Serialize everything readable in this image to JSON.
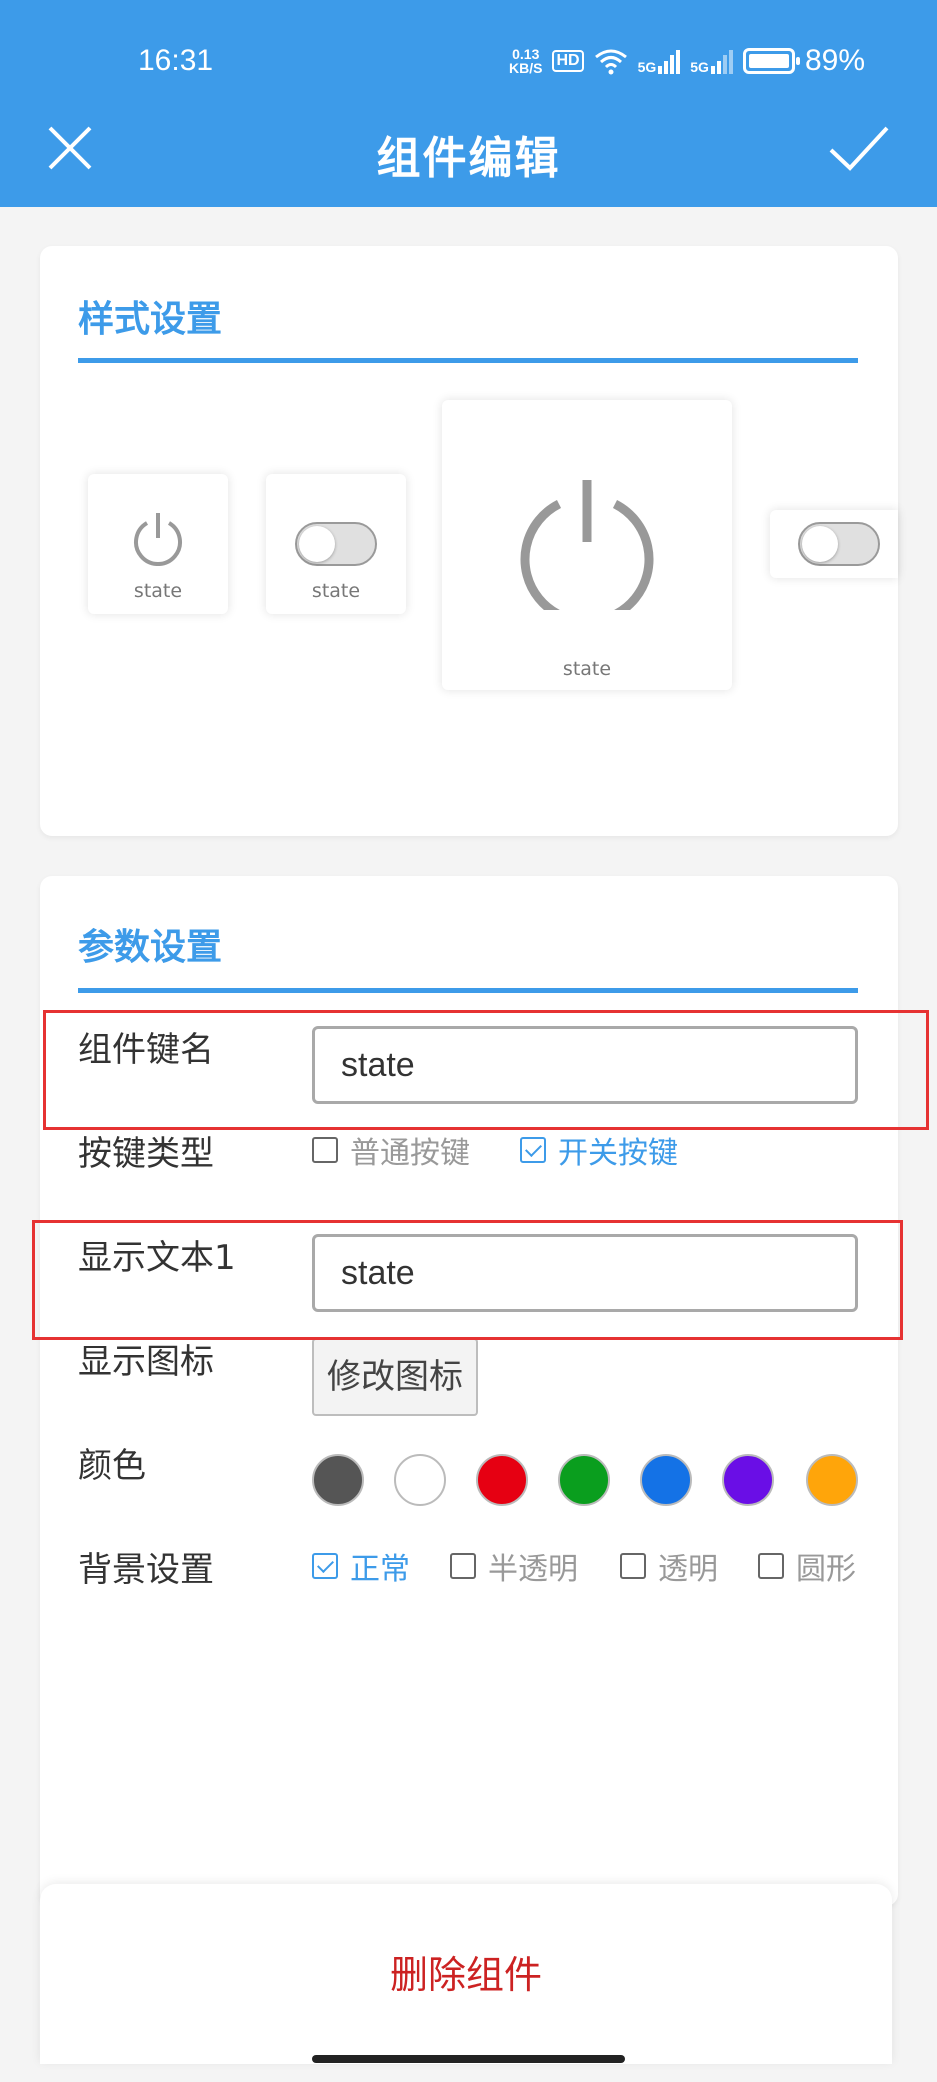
{
  "status_bar": {
    "time": "16:31",
    "net_speed_value": "0.13",
    "net_speed_unit": "KB/S",
    "hd_badge": "HD",
    "signal1_label": "5G",
    "signal2_label": "5G",
    "battery_percent": "89%"
  },
  "header": {
    "title": "组件编辑",
    "close_icon": "close-icon",
    "confirm_icon": "checkmark-icon"
  },
  "style_section": {
    "title": "样式设置",
    "previews": [
      {
        "icon": "power-icon",
        "label": "state"
      },
      {
        "icon": "toggle-switch",
        "label": "state"
      },
      {
        "icon": "power-icon",
        "label": "state"
      },
      {
        "icon": "toggle-switch",
        "label": ""
      }
    ]
  },
  "params_section": {
    "title": "参数设置",
    "key_name": {
      "label": "组件键名",
      "value": "state"
    },
    "key_type": {
      "label": "按键类型",
      "options": [
        {
          "label": "普通按键",
          "checked": false
        },
        {
          "label": "开关按键",
          "checked": true
        }
      ]
    },
    "display_text": {
      "label": "显示文本1",
      "value": "state"
    },
    "display_icon": {
      "label": "显示图标",
      "button": "修改图标"
    },
    "color": {
      "label": "颜色",
      "swatches": [
        "#555555",
        "#ffffff",
        "#e60012",
        "#0a9e1e",
        "#1472e6",
        "#6a0ee6",
        "#ffa50a"
      ]
    },
    "background": {
      "label": "背景设置",
      "options": [
        {
          "label": "正常",
          "checked": true
        },
        {
          "label": "半透明",
          "checked": false
        },
        {
          "label": "透明",
          "checked": false
        },
        {
          "label": "圆形",
          "checked": false
        }
      ]
    }
  },
  "bottom_sheet": {
    "delete_label": "删除组件"
  },
  "colors": {
    "accent": "#3d9be9",
    "danger": "#cc2222",
    "highlight_box": "#e63232"
  }
}
